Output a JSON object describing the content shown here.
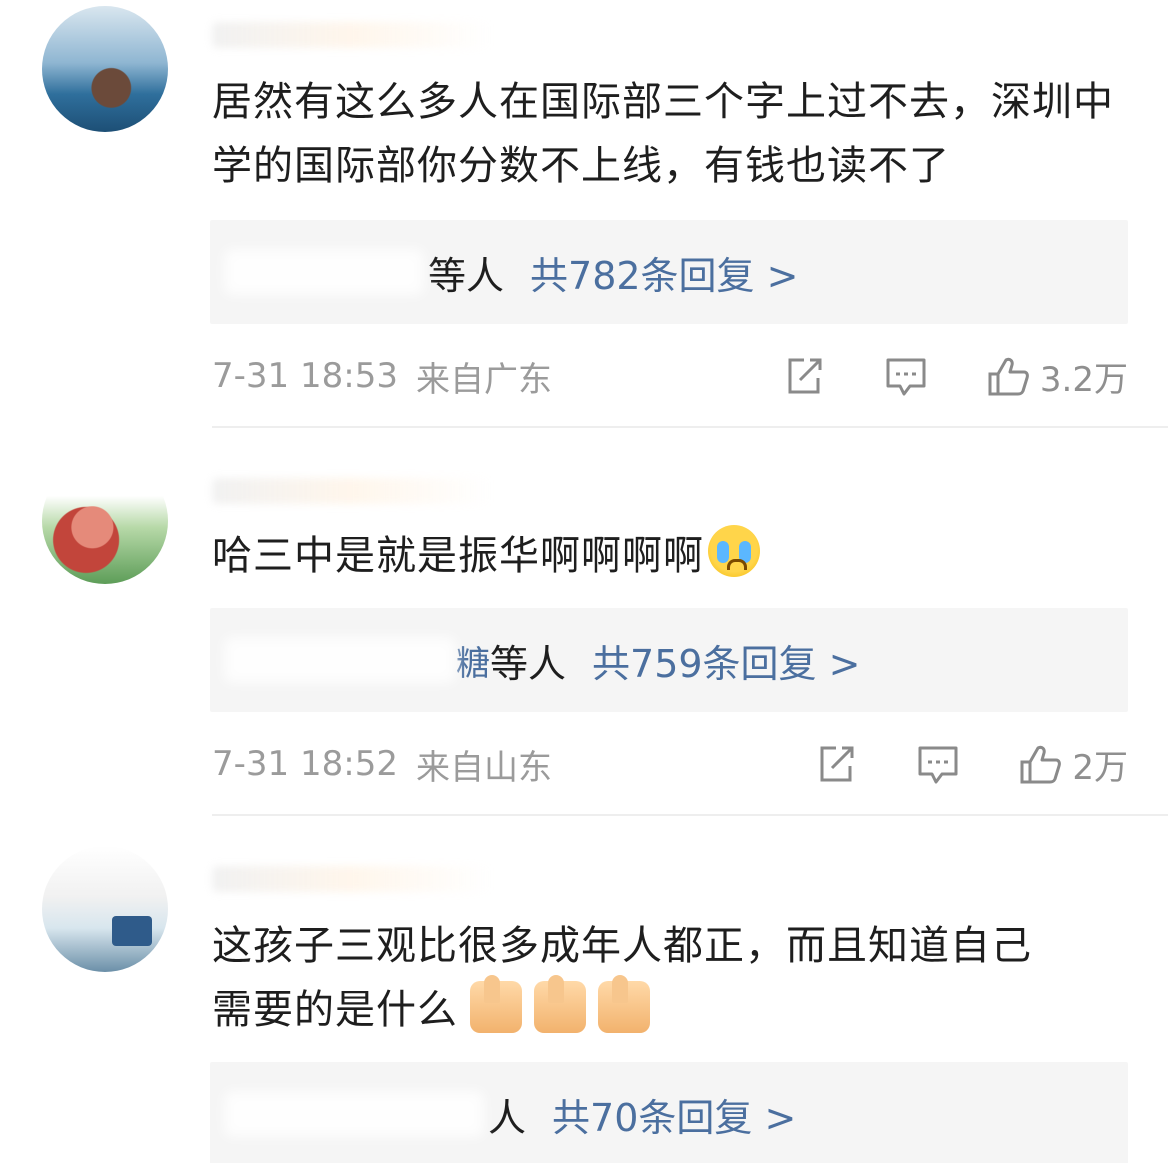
{
  "comments": [
    {
      "text": "居然有这么多人在国际部三个字上过不去，深圳中学的国际部你分数不上线，有钱也读不了",
      "replies": {
        "who": "等人",
        "count": "共782条回复 >"
      },
      "time": "7-31 18:53",
      "location": "来自广东",
      "likes": "3.2万"
    },
    {
      "text": "哈三中是就是振华啊啊啊啊",
      "replies": {
        "who_prefix": "糖",
        "who": "等人",
        "count": "共759条回复 >"
      },
      "time": "7-31 18:52",
      "location": "来自山东",
      "likes": "2万"
    },
    {
      "text_line1": "这孩子三观比很多成年人都正，而且知道自己",
      "text_line2": "需要的是什么",
      "replies": {
        "who": "人",
        "count": "共70条回复 >"
      }
    }
  ],
  "icons": {
    "share": "share-icon",
    "comment": "comment-icon",
    "like": "thumbs-up-icon",
    "emoji_cry": "crying-face-emoji",
    "emoji_thumb": "thumbs-up-emoji"
  },
  "colors": {
    "link": "#4b6f9f",
    "meta": "#9b9b9b",
    "reply_bg": "#f5f5f5"
  }
}
